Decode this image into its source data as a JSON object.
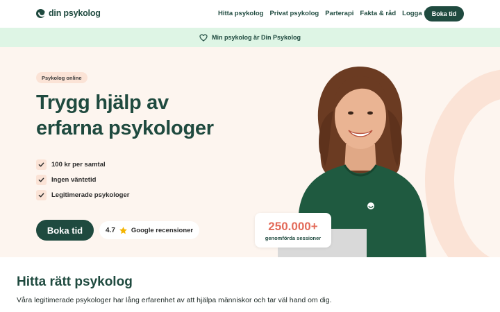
{
  "header": {
    "logo_text": "din psykolog",
    "nav": [
      "Hitta psykolog",
      "Privat psykolog",
      "Parterapi",
      "Fakta & råd",
      "Logga in"
    ],
    "cta_label": "Boka tid"
  },
  "banner": {
    "icon": "heart-icon",
    "text": "Min psykolog är Din Psykolog"
  },
  "hero": {
    "badge": "Psykolog online",
    "title_line1": "Trygg hjälp av",
    "title_line2": "erfarna psykologer",
    "checks": [
      "100 kr per samtal",
      "Ingen väntetid",
      "Legitimerade psykologer"
    ],
    "cta_label": "Boka tid",
    "rating_value": "4.7",
    "rating_icon": "star-icon",
    "rating_label": "Google recensioner",
    "stat_value": "250.000+",
    "stat_label": "genomförda sessioner"
  },
  "section": {
    "title": "Hitta rätt psykolog",
    "text": "Våra legitimerade psykologer har lång erfarenhet av att hjälpa människor och tar väl hand om dig."
  },
  "colors": {
    "brand": "#1f4a3f",
    "banner_bg": "#def5e5",
    "hero_bg": "#fdf5ef",
    "accent_peach": "#fbe3d6",
    "stat_red": "#e36b5a",
    "star_yellow": "#f4b400"
  }
}
